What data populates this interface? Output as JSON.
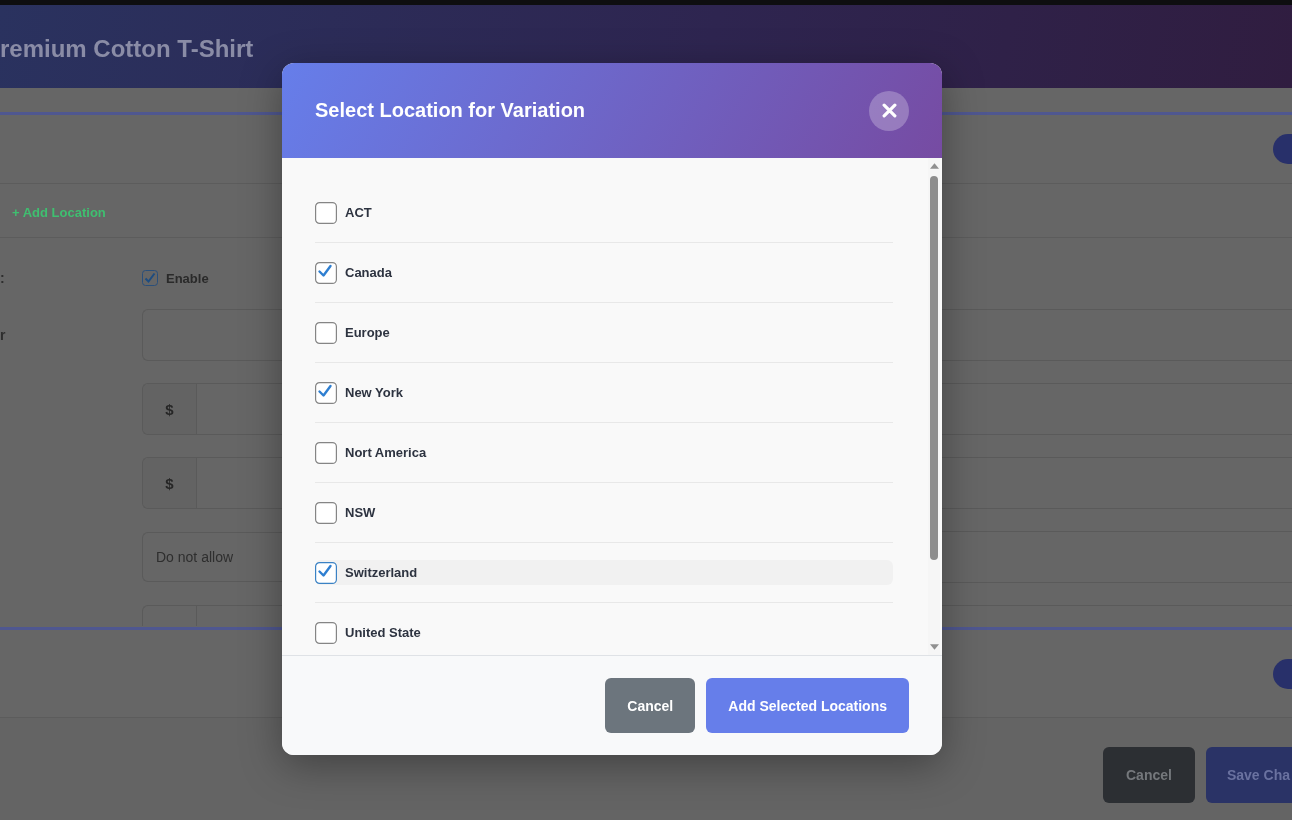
{
  "page_header": {
    "title": "remium Cotton T-Shirt"
  },
  "locations_card": {
    "add_link": "+ Add Location",
    "fields": [
      {
        "kind": "checkbox",
        "label": ":",
        "option": "Enable",
        "checked": true
      },
      {
        "kind": "text",
        "label": "r"
      },
      {
        "kind": "price",
        "prefix": "$"
      },
      {
        "kind": "price",
        "prefix": "$"
      },
      {
        "kind": "select",
        "value": "Do not allow"
      },
      {
        "kind": "stub"
      }
    ]
  },
  "footer_buttons": [
    {
      "label": "Cancel",
      "kind": "secondary"
    },
    {
      "label": "Save Cha",
      "kind": "primary"
    }
  ],
  "modal": {
    "title": "Select Location for Variation",
    "options": [
      {
        "label": "ACT",
        "checked": false,
        "highlighted": false
      },
      {
        "label": "Canada",
        "checked": true,
        "highlighted": false
      },
      {
        "label": "Europe",
        "checked": false,
        "highlighted": false
      },
      {
        "label": "New York",
        "checked": true,
        "highlighted": false
      },
      {
        "label": "Nort America",
        "checked": false,
        "highlighted": false
      },
      {
        "label": "NSW",
        "checked": false,
        "highlighted": false
      },
      {
        "label": "Switzerland",
        "checked": true,
        "highlighted": true
      },
      {
        "label": "United State",
        "checked": false,
        "highlighted": false
      }
    ],
    "buttons": [
      {
        "label": "Cancel",
        "kind": "secondary"
      },
      {
        "label": "Add Selected Locations",
        "kind": "primary"
      }
    ]
  }
}
